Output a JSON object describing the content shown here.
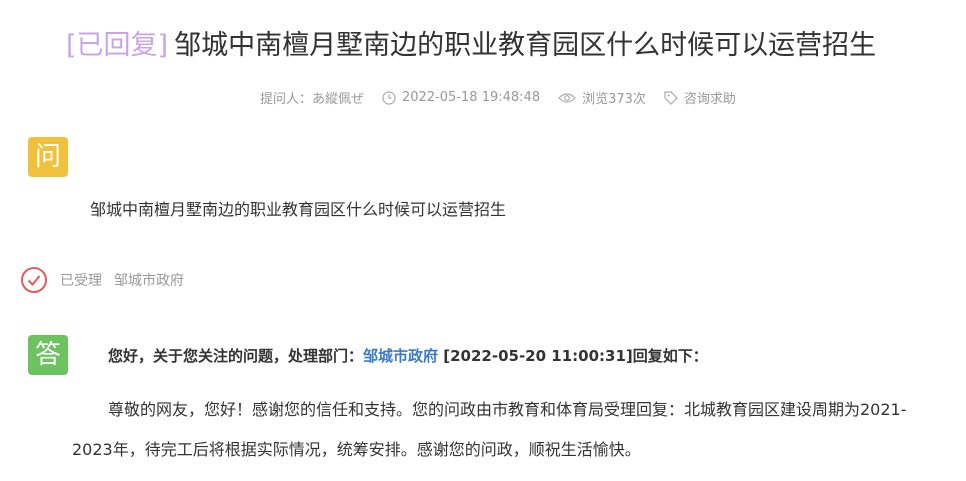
{
  "title": {
    "tag": "[已回复]",
    "text": "邹城中南檀月墅南边的职业教育园区什么时候可以运营招生"
  },
  "meta": {
    "asker": "提问人：あ縱佩ぜ",
    "time": "2022-05-18 19:48:48",
    "views": "浏览373次",
    "category": "咨询求助"
  },
  "question": {
    "badge": "问",
    "text": "邹城中南檀月墅南边的职业教育园区什么时候可以运营招生"
  },
  "status": {
    "label": "已受理",
    "department": "邹城市政府"
  },
  "answer": {
    "badge": "答",
    "head_prefix": "您好，关于您关注的问题，处理部门：",
    "head_dept": "邹城市政府",
    "head_suffix": " [2022-05-20 11:00:31]回复如下：",
    "body": "尊敬的网友，您好！感谢您的信任和支持。您的问政由市教育和体育局受理回复：北城教育园区建设周期为2021-2023年，待完工后将根据实际情况，统筹安排。感谢您的问政，顺祝生活愉快。"
  },
  "colors": {
    "tag": "#c9a5e6",
    "question_badge": "#f0c13a",
    "answer_badge": "#6cc360",
    "status_icon": "#e45b5b",
    "dept_link": "#3a7bc8"
  }
}
